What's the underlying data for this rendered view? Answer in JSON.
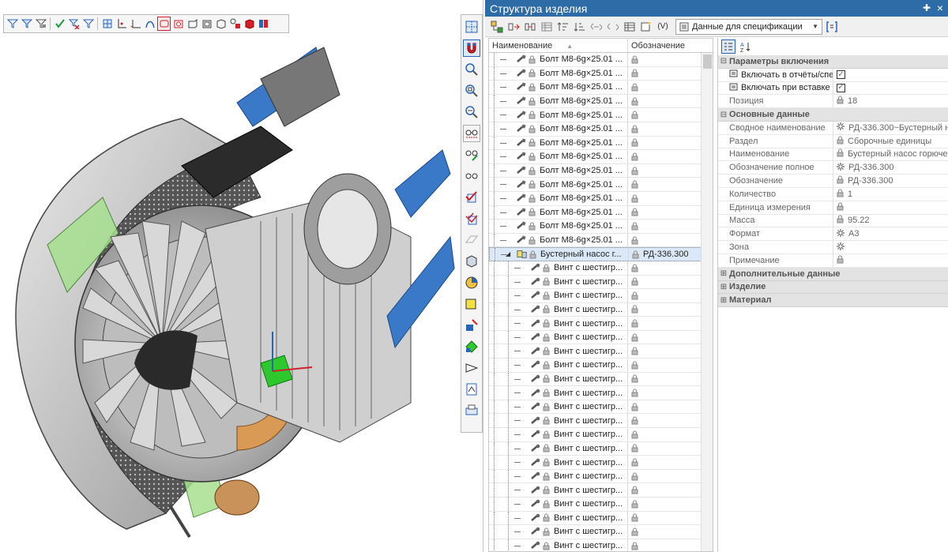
{
  "panel": {
    "title": "Структура изделия"
  },
  "toolbar": {
    "spec_select": "Данные для спецификации"
  },
  "tree": {
    "headers": {
      "name": "Наименование",
      "designation": "Обозначение"
    },
    "rows": [
      {
        "name": "Болт М8-6g×25.01 ...",
        "designation": "",
        "level": 1,
        "icon": "bolt-icon"
      },
      {
        "name": "Болт М8-6g×25.01 ...",
        "designation": "",
        "level": 1,
        "icon": "bolt-icon"
      },
      {
        "name": "Болт М8-6g×25.01 ...",
        "designation": "",
        "level": 1,
        "icon": "bolt-icon"
      },
      {
        "name": "Болт М8-6g×25.01 ...",
        "designation": "",
        "level": 1,
        "icon": "bolt-icon"
      },
      {
        "name": "Болт М8-6g×25.01 ...",
        "designation": "",
        "level": 1,
        "icon": "bolt-icon"
      },
      {
        "name": "Болт М8-6g×25.01 ...",
        "designation": "",
        "level": 1,
        "icon": "bolt-icon"
      },
      {
        "name": "Болт М8-6g×25.01 ...",
        "designation": "",
        "level": 1,
        "icon": "bolt-icon"
      },
      {
        "name": "Болт М8-6g×25.01 ...",
        "designation": "",
        "level": 1,
        "icon": "bolt-icon"
      },
      {
        "name": "Болт М8-6g×25.01 ...",
        "designation": "",
        "level": 1,
        "icon": "bolt-icon"
      },
      {
        "name": "Болт М8-6g×25.01 ...",
        "designation": "",
        "level": 1,
        "icon": "bolt-icon"
      },
      {
        "name": "Болт М8-6g×25.01 ...",
        "designation": "",
        "level": 1,
        "icon": "bolt-icon"
      },
      {
        "name": "Болт М8-6g×25.01 ...",
        "designation": "",
        "level": 1,
        "icon": "bolt-icon"
      },
      {
        "name": "Болт М8-6g×25.01 ...",
        "designation": "",
        "level": 1,
        "icon": "bolt-icon"
      },
      {
        "name": "Болт М8-6g×25.01 ...",
        "designation": "",
        "level": 1,
        "icon": "bolt-icon"
      },
      {
        "name": "Бустерный насос г...",
        "designation": "РД-336.300",
        "level": 1,
        "icon": "assembly-icon",
        "expanded": true,
        "selected": true
      },
      {
        "name": "Винт с шестигр...",
        "designation": "",
        "level": 2,
        "icon": "screw-icon"
      },
      {
        "name": "Винт с шестигр...",
        "designation": "",
        "level": 2,
        "icon": "screw-icon"
      },
      {
        "name": "Винт с шестигр...",
        "designation": "",
        "level": 2,
        "icon": "screw-icon"
      },
      {
        "name": "Винт с шестигр...",
        "designation": "",
        "level": 2,
        "icon": "screw-icon"
      },
      {
        "name": "Винт с шестигр...",
        "designation": "",
        "level": 2,
        "icon": "screw-icon"
      },
      {
        "name": "Винт с шестигр...",
        "designation": "",
        "level": 2,
        "icon": "screw-icon"
      },
      {
        "name": "Винт с шестигр...",
        "designation": "",
        "level": 2,
        "icon": "screw-icon"
      },
      {
        "name": "Винт с шестигр...",
        "designation": "",
        "level": 2,
        "icon": "screw-icon"
      },
      {
        "name": "Винт с шестигр...",
        "designation": "",
        "level": 2,
        "icon": "screw-icon"
      },
      {
        "name": "Винт с шестигр...",
        "designation": "",
        "level": 2,
        "icon": "screw-icon"
      },
      {
        "name": "Винт с шестигр...",
        "designation": "",
        "level": 2,
        "icon": "screw-icon"
      },
      {
        "name": "Винт с шестигр...",
        "designation": "",
        "level": 2,
        "icon": "screw-icon"
      },
      {
        "name": "Винт с шестигр...",
        "designation": "",
        "level": 2,
        "icon": "screw-icon"
      },
      {
        "name": "Винт с шестигр...",
        "designation": "",
        "level": 2,
        "icon": "screw-icon"
      },
      {
        "name": "Винт с шестигр...",
        "designation": "",
        "level": 2,
        "icon": "screw-icon"
      },
      {
        "name": "Винт с шестигр...",
        "designation": "",
        "level": 2,
        "icon": "screw-icon"
      },
      {
        "name": "Винт с шестигр...",
        "designation": "",
        "level": 2,
        "icon": "screw-icon"
      },
      {
        "name": "Винт с шестигр...",
        "designation": "",
        "level": 2,
        "icon": "screw-icon"
      },
      {
        "name": "Винт с шестигр...",
        "designation": "",
        "level": 2,
        "icon": "screw-icon"
      },
      {
        "name": "Винт с шестигр...",
        "designation": "",
        "level": 2,
        "icon": "screw-icon"
      },
      {
        "name": "Винт с шестигр...",
        "designation": "",
        "level": 2,
        "icon": "screw-icon"
      },
      {
        "name": "Винт с шестигр...",
        "designation": "",
        "level": 2,
        "icon": "screw-icon"
      }
    ]
  },
  "properties": {
    "groups": [
      {
        "title": "Параметры включения",
        "expanded": true,
        "rows": [
          {
            "key": "Включать в отчёты/спе",
            "value": "",
            "checkbox": true,
            "checked": true,
            "key_icon": "report-icon"
          },
          {
            "key": "Включать при вставке",
            "value": "",
            "checkbox": true,
            "checked": true,
            "key_icon": "insert-icon"
          },
          {
            "key": "Позиция",
            "value": "18",
            "lock": true
          }
        ]
      },
      {
        "title": "Основные данные",
        "expanded": true,
        "rows": [
          {
            "key": "Сводное наименование",
            "value": "РД-336.300~Бустерный н",
            "gear": true
          },
          {
            "key": "Раздел",
            "value": "Сборочные единицы",
            "lock": true
          },
          {
            "key": "Наименование",
            "value": "Бустерный насос горюче",
            "lock": true
          },
          {
            "key": "Обозначение полное",
            "value": "РД-336.300",
            "gear": true
          },
          {
            "key": "Обозначение",
            "value": "РД-336.300",
            "lock": true
          },
          {
            "key": "Количество",
            "value": "1",
            "lock": true
          },
          {
            "key": "Единица измерения",
            "value": "",
            "lock": true
          },
          {
            "key": "Масса",
            "value": "95.22",
            "lock": true
          },
          {
            "key": "Формат",
            "value": "А3",
            "gear": true
          },
          {
            "key": "Зона",
            "value": "",
            "gear": true
          },
          {
            "key": "Примечание",
            "value": "",
            "lock": true
          }
        ]
      },
      {
        "title": "Дополнительные данные",
        "expanded": false,
        "rows": []
      },
      {
        "title": "Изделие",
        "expanded": false,
        "rows": []
      },
      {
        "title": "Материал",
        "expanded": false,
        "rows": []
      }
    ]
  },
  "colors": {
    "title_bar": "#2e6ca8",
    "selection": "#dbe8f7",
    "group_bg": "#e3e3e3",
    "accent_red": "#d0202a",
    "accent_blue": "#2a64b8"
  }
}
